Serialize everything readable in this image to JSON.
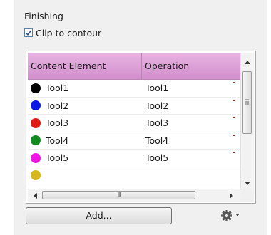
{
  "section": {
    "title": "Finishing"
  },
  "clip_checkbox": {
    "label": "Clip to contour",
    "checked": true
  },
  "table": {
    "columns": [
      "Content Element",
      "Operation"
    ],
    "rows": [
      {
        "content": "Tool1",
        "operation": "Tool1",
        "color": "#000000"
      },
      {
        "content": "Tool2",
        "operation": "Tool2",
        "color": "#0a18e6"
      },
      {
        "content": "Tool3",
        "operation": "Tool3",
        "color": "#e01b14"
      },
      {
        "content": "Tool4",
        "operation": "Tool4",
        "color": "#138a1e"
      },
      {
        "content": "Tool5",
        "operation": "Tool5",
        "color": "#f014e6"
      },
      {
        "content": "",
        "operation": "",
        "color": "#d6b81a"
      }
    ],
    "header_color": "#d9a0d4"
  },
  "scrollbars": {
    "hscroll_grip": "III"
  },
  "buttons": {
    "add_label": "Add...",
    "settings_icon": "gear-icon"
  }
}
